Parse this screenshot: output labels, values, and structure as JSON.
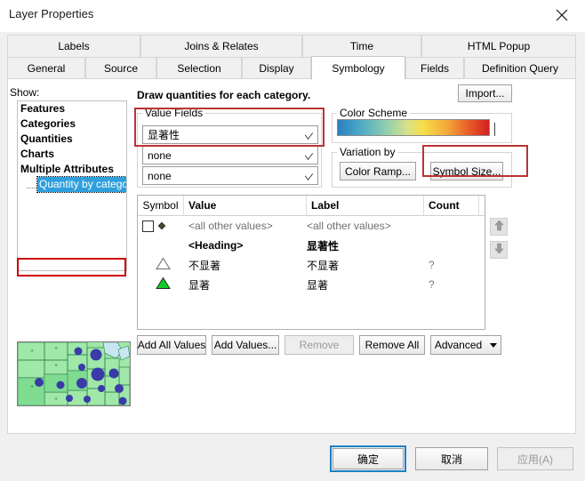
{
  "window": {
    "title": "Layer Properties",
    "close_icon": "close-icon"
  },
  "tabs": {
    "row_top": [
      {
        "label": "Labels",
        "selected": false
      },
      {
        "label": "Joins & Relates",
        "selected": false
      },
      {
        "label": "Time",
        "selected": false
      },
      {
        "label": "HTML Popup",
        "selected": false
      }
    ],
    "row_bottom": [
      {
        "label": "General",
        "selected": false
      },
      {
        "label": "Source",
        "selected": false
      },
      {
        "label": "Selection",
        "selected": false
      },
      {
        "label": "Display",
        "selected": false
      },
      {
        "label": "Symbology",
        "selected": true
      },
      {
        "label": "Fields",
        "selected": false
      },
      {
        "label": "Definition Query",
        "selected": false
      }
    ]
  },
  "show": {
    "label": "Show:",
    "items": [
      {
        "label": "Features"
      },
      {
        "label": "Categories"
      },
      {
        "label": "Quantities"
      },
      {
        "label": "Charts"
      },
      {
        "label": "Multiple Attributes"
      }
    ],
    "child": {
      "label": "Quantity by category",
      "selected": true
    }
  },
  "main": {
    "heading": "Draw quantities for each category.",
    "import_label": "Import...",
    "value_fields": {
      "title": "Value Fields",
      "field1": "显著性",
      "field2": "none",
      "field3": "none"
    },
    "color_scheme": {
      "title": "Color Scheme",
      "ramp_name": "blue-cyan-yellow-orange-red"
    },
    "variation_by": {
      "title": "Variation by",
      "color_ramp_label": "Color Ramp...",
      "symbol_size_label": "Symbol Size..."
    },
    "table": {
      "headers": [
        "Symbol",
        "Value",
        "Label",
        "Count"
      ],
      "rows": [
        {
          "kind": "checkbox",
          "symbol": "checkbox-dot",
          "value": "<all other values>",
          "label": "<all other values>",
          "count": ""
        },
        {
          "kind": "heading",
          "symbol": "",
          "value": "<Heading>",
          "label": "显著性",
          "count": ""
        },
        {
          "kind": "triangle-outline",
          "symbol": "triangle-outline",
          "value": "不显著",
          "label": "不显著",
          "count": "?"
        },
        {
          "kind": "triangle-green",
          "symbol": "triangle-filled-green",
          "value": "显著",
          "label": "显著",
          "count": "?"
        }
      ]
    },
    "order_buttons": {
      "up": "move-up-icon",
      "down": "move-down-icon"
    },
    "actions": {
      "add_all_values": "Add All Values",
      "add_values": "Add Values...",
      "remove": "Remove",
      "remove_all": "Remove All",
      "advanced": "Advanced"
    }
  },
  "footer": {
    "ok": "确定",
    "cancel": "取消",
    "apply": "应用(A)"
  },
  "colors": {
    "accent_blue": "#1a82c4",
    "highlight_red": "#bb3333",
    "selection_blue": "#2f9fdc",
    "symbol_green": "#11cc22",
    "map_land": "#9fe8a8",
    "map_circle": "#3a3aa8"
  }
}
